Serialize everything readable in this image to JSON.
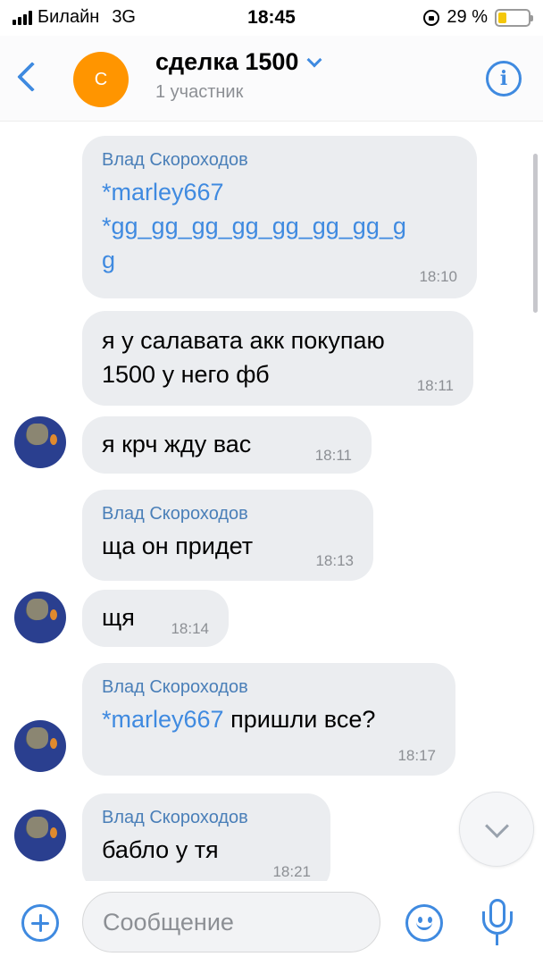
{
  "status_bar": {
    "carrier": "Билайн",
    "network": "3G",
    "time": "18:45",
    "battery": "29 %",
    "battery_level": 0.29
  },
  "header": {
    "avatar_letter": "С",
    "title": "сделка 1500",
    "subtitle": "1 участник"
  },
  "messages": [
    {
      "author": "Влад Скороходов",
      "parts": [
        {
          "mention": "*marley667"
        },
        {
          "mention": "*gg_gg_gg_gg_gg_gg_gg_g"
        },
        {
          "mention": "g"
        }
      ],
      "time": "18:10"
    },
    {
      "author": "",
      "text_lines": [
        "я у салавата акк покупаю",
        "1500 у него фб"
      ],
      "time": "18:11"
    },
    {
      "author": "",
      "text": "я крч жду вас",
      "time": "18:11"
    },
    {
      "author": "Влад Скороходов",
      "text": "ща он придет",
      "time": "18:13"
    },
    {
      "author": "",
      "text": "щя",
      "time": "18:14"
    },
    {
      "author": "Влад Скороходов",
      "mention": "*marley667",
      "text": " пришли все?",
      "time": "18:17"
    },
    {
      "author": "Влад Скороходов",
      "text": "бабло у тя",
      "time": "18:21"
    }
  ],
  "composer": {
    "placeholder": "Сообщение"
  },
  "colors": {
    "accent": "#3f8ae0",
    "bubble": "#ebedf0",
    "avatar_orange": "#ff9500"
  }
}
